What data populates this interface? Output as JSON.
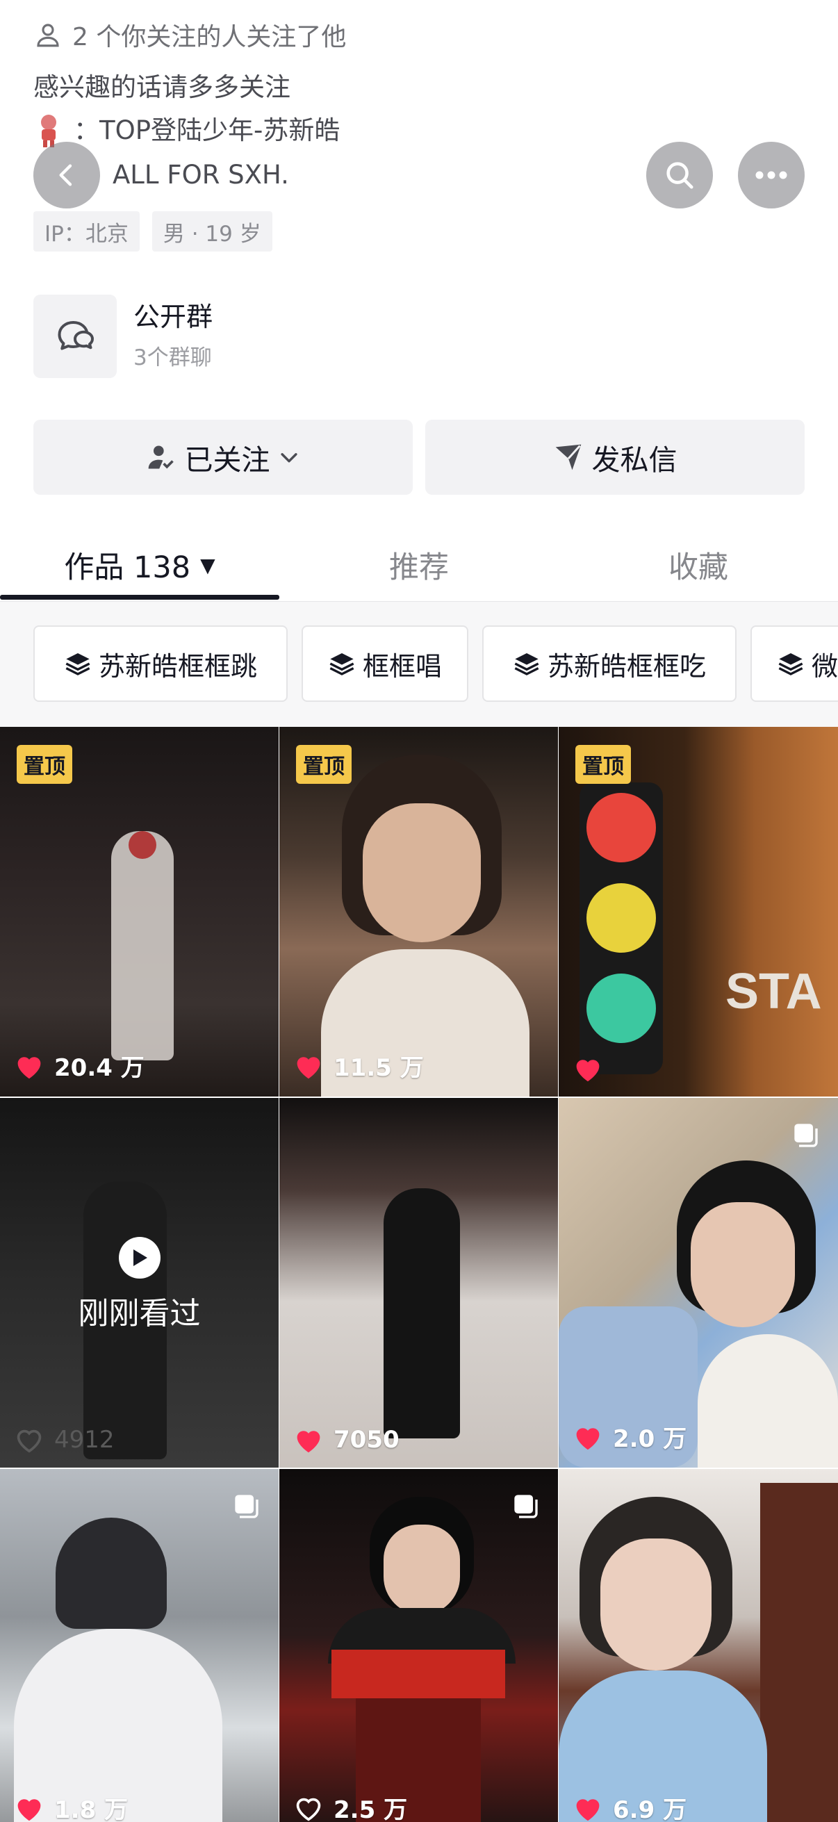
{
  "profile": {
    "mutual_follow_text": "2 个你关注的人关注了他",
    "bio_line1": "感兴趣的话请多多关注",
    "bio_line2": "：TOP登陆少年-苏新皓",
    "bio_line3": "ALL FOR SXH.",
    "tags": [
      "IP：北京",
      "男 · 19 岁"
    ]
  },
  "group": {
    "title": "公开群",
    "subtitle": "3个群聊"
  },
  "actions": {
    "follow_label": "已关注",
    "message_label": "发私信"
  },
  "tabs": [
    {
      "label": "作品 138",
      "active": true
    },
    {
      "label": "推荐",
      "active": false
    },
    {
      "label": "收藏",
      "active": false
    }
  ],
  "collections": [
    "苏新皓框框跳",
    "框框唱",
    "苏新皓框框吃",
    "微"
  ],
  "grid": {
    "pinned_label": "置顶",
    "viewed_label": "刚刚看过",
    "items": [
      {
        "likes": "20.4 万",
        "pinned": true,
        "liked": true
      },
      {
        "likes": "11.5 万",
        "pinned": true,
        "liked": true
      },
      {
        "likes": "",
        "pinned": true,
        "liked": true
      },
      {
        "likes": "4912",
        "pinned": false,
        "liked": false,
        "viewed": true
      },
      {
        "likes": "7050",
        "pinned": false,
        "liked": true
      },
      {
        "likes": "2.0 万",
        "pinned": false,
        "liked": true,
        "multi": true
      },
      {
        "likes": "1.8 万",
        "pinned": false,
        "liked": true,
        "multi": true
      },
      {
        "likes": "2.5 万",
        "pinned": false,
        "liked": false,
        "multi": true
      },
      {
        "likes": "6.9 万",
        "pinned": false,
        "liked": true
      }
    ]
  },
  "colors": {
    "heart": "#fe2c55",
    "pin_badge": "#f5c84b",
    "text_primary": "#161823",
    "text_secondary": "#86878c"
  },
  "icons": [
    "person-icon",
    "back-icon",
    "search-icon",
    "more-icon",
    "chat-icon",
    "person-check-icon",
    "chevron-down-icon",
    "send-icon",
    "layers-icon",
    "heart-icon",
    "play-icon",
    "multi-photo-icon"
  ]
}
